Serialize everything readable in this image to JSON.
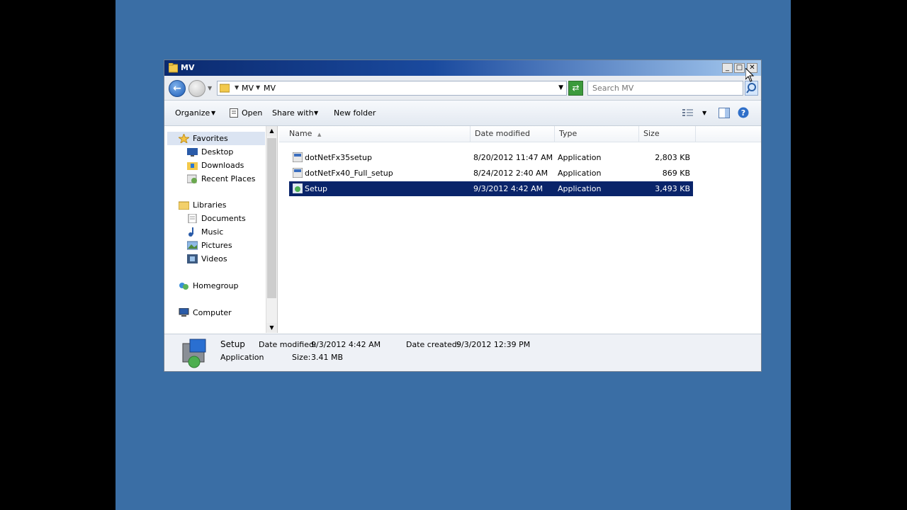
{
  "window": {
    "title": "MV",
    "controls": {
      "minimize": "_",
      "maximize": "□",
      "close": "✕"
    }
  },
  "address": {
    "crumbs": [
      "MV",
      "MV"
    ],
    "search_placeholder": "Search MV"
  },
  "toolbar": {
    "organize": "Organize",
    "open": "Open",
    "share_with": "Share with",
    "new_folder": "New folder"
  },
  "nav": {
    "favorites": {
      "label": "Favorites",
      "items": [
        "Desktop",
        "Downloads",
        "Recent Places"
      ]
    },
    "libraries": {
      "label": "Libraries",
      "items": [
        "Documents",
        "Music",
        "Pictures",
        "Videos"
      ]
    },
    "homegroup": "Homegroup",
    "computer": "Computer"
  },
  "columns": {
    "name": "Name",
    "date": "Date modified",
    "type": "Type",
    "size": "Size"
  },
  "files": [
    {
      "name": "dotNetFx35setup",
      "date": "8/20/2012 11:47 AM",
      "type": "Application",
      "size": "2,803 KB"
    },
    {
      "name": "dotNetFx40_Full_setup",
      "date": "8/24/2012 2:40 AM",
      "type": "Application",
      "size": "869 KB"
    },
    {
      "name": "Setup",
      "date": "9/3/2012 4:42 AM",
      "type": "Application",
      "size": "3,493 KB"
    }
  ],
  "details": {
    "name": "Setup",
    "type": "Application",
    "date_modified_label": "Date modified:",
    "date_modified": "9/3/2012 4:42 AM",
    "date_created_label": "Date created:",
    "date_created": "9/3/2012 12:39 PM",
    "size_label": "Size:",
    "size": "3.41 MB"
  },
  "colors": {
    "desktop": "#3a6ea5",
    "selection": "#0a246a",
    "titlebar": "#0b2a6f"
  }
}
